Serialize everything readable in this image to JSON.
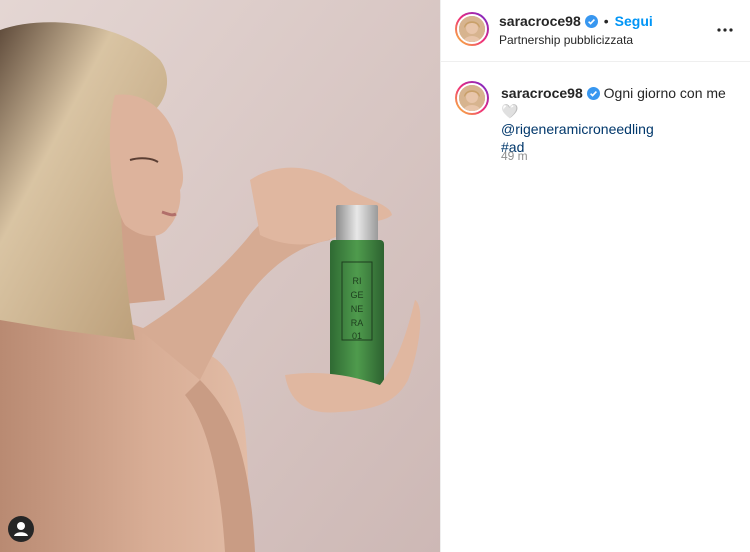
{
  "post": {
    "username": "saracroce98",
    "follow_label": "Segui",
    "sponsor_line": "Partnership pubblicizzata",
    "dot": "•",
    "more_icon": "more-horizontal-icon",
    "caption_text": "Ogni giorno con me🤍",
    "mention": "@rigeneramicroneedling",
    "hashtag": "#ad",
    "time_ago": "49 m",
    "verified_color": "#3897f0",
    "follow_color": "#0095f6"
  },
  "product": {
    "label_text": "RI GE NE RA 01"
  }
}
